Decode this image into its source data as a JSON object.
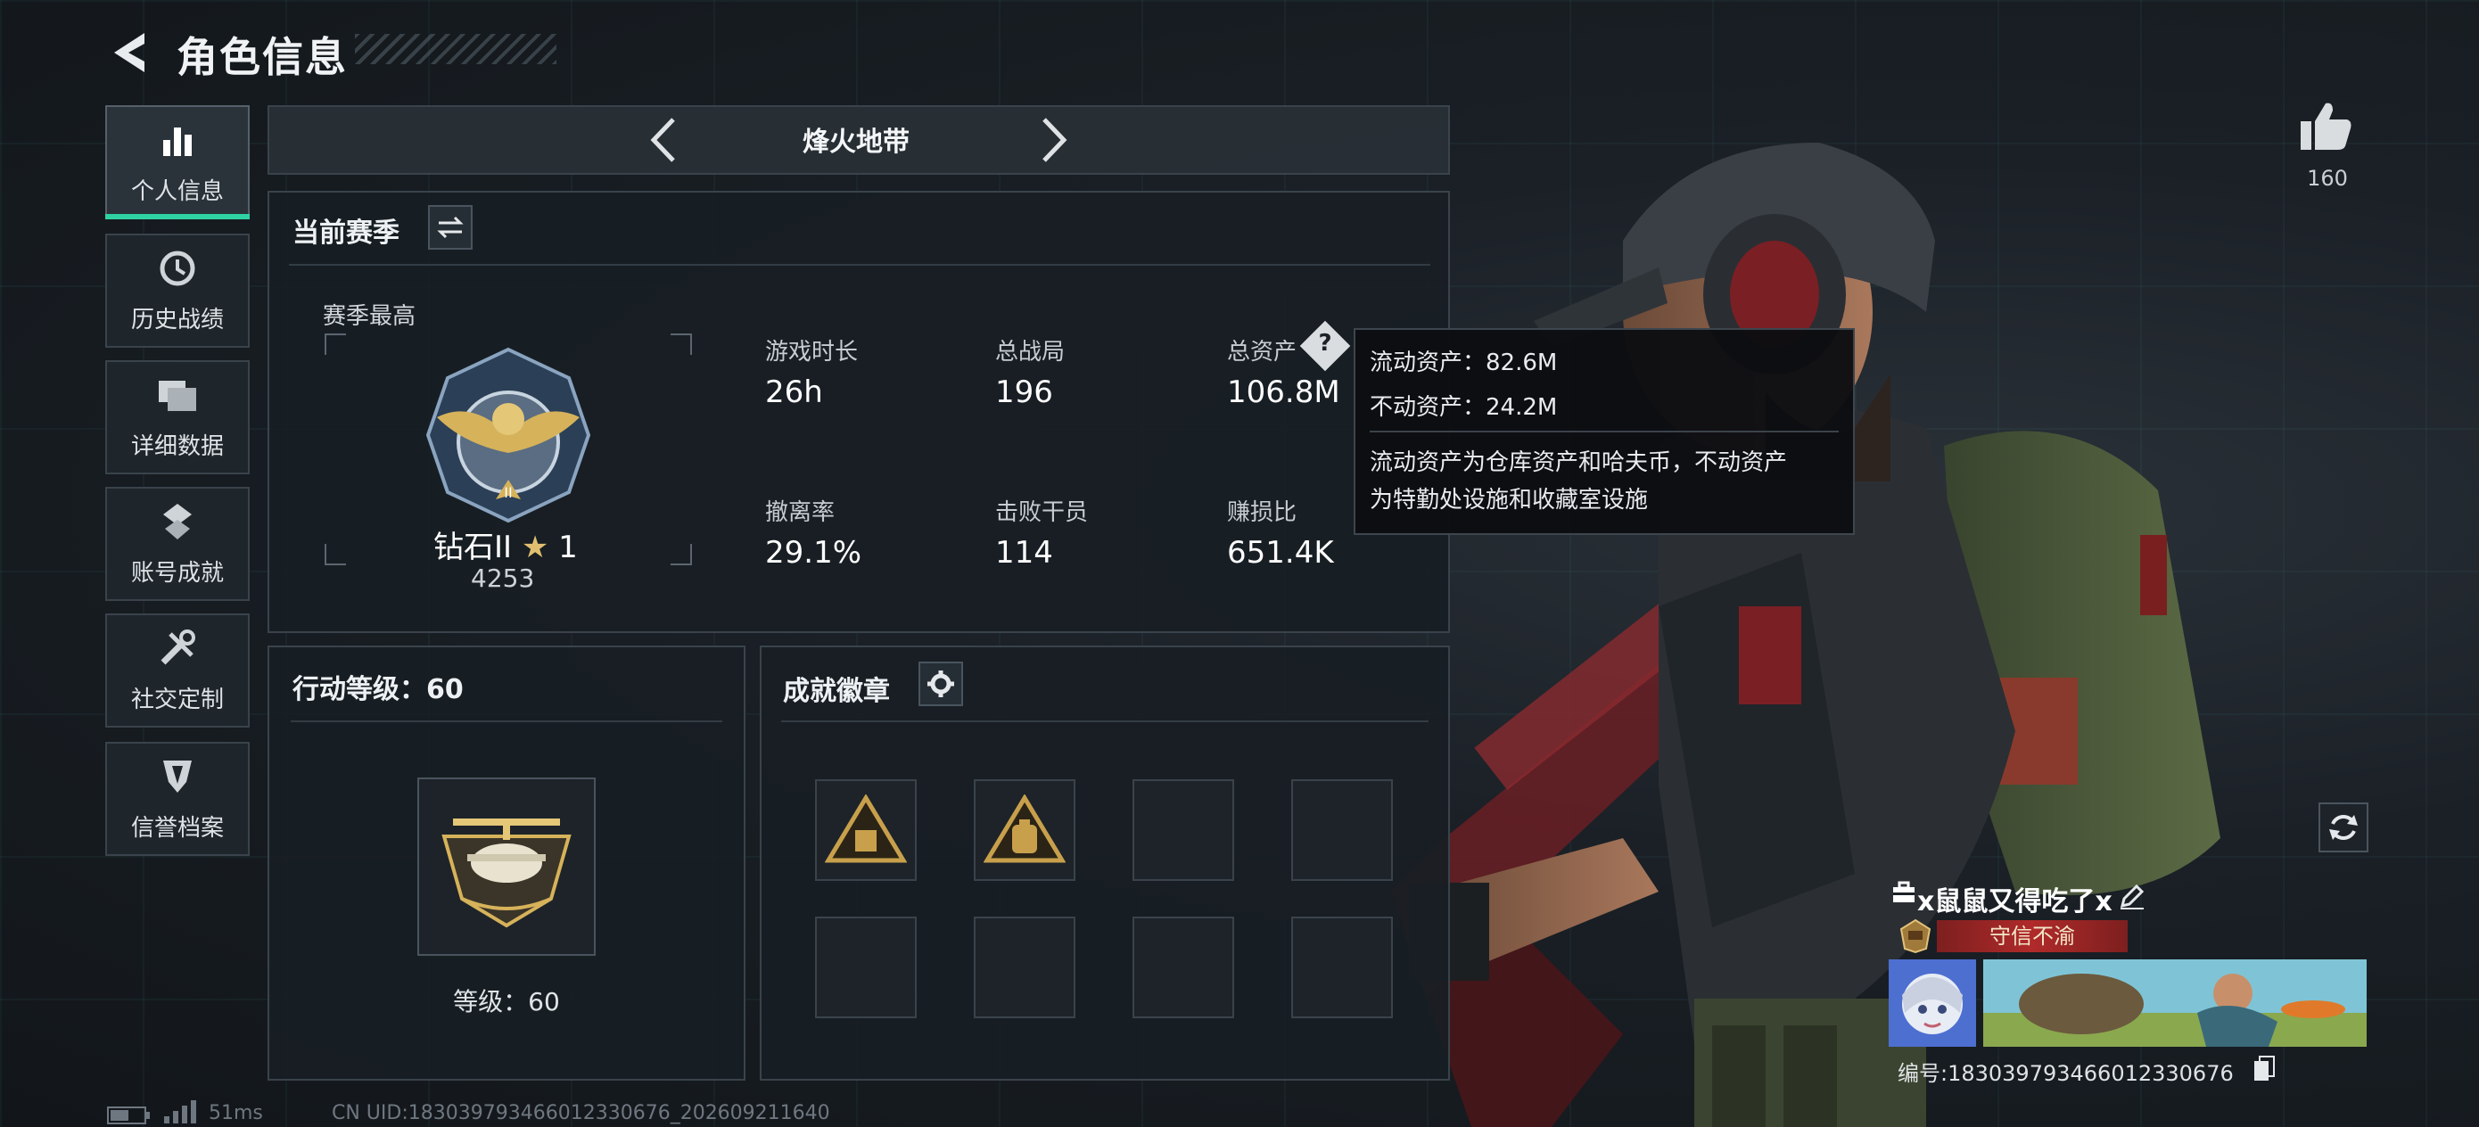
{
  "header": {
    "title": "角色信息"
  },
  "nav": [
    {
      "label": "个人信息",
      "icon": "bar-chart-icon",
      "active": true
    },
    {
      "label": "历史战绩",
      "icon": "history-clock-icon",
      "active": false
    },
    {
      "label": "详细数据",
      "icon": "folders-icon",
      "active": false
    },
    {
      "label": "账号成就",
      "icon": "achievement-icon",
      "active": false
    },
    {
      "label": "社交定制",
      "icon": "tools-icon",
      "active": false
    },
    {
      "label": "信誉档案",
      "icon": "reputation-icon",
      "active": false
    }
  ],
  "mode_tab": {
    "title": "烽火地带"
  },
  "season": {
    "title": "当前赛季",
    "best_label": "赛季最高",
    "rank_name": "钻石II",
    "rank_stars": "1",
    "rank_score": "4253",
    "stats": [
      {
        "label": "游戏时长",
        "value": "26h"
      },
      {
        "label": "总战局",
        "value": "196"
      },
      {
        "label": "总资产",
        "value": "106.8M"
      },
      {
        "label": "撤离率",
        "value": "29.1%"
      },
      {
        "label": "击败干员",
        "value": "114"
      },
      {
        "label": "赚损比",
        "value": "651.4K"
      }
    ]
  },
  "tooltip": {
    "liquid": "流动资产：82.6M",
    "fixed": "不动资产：24.2M",
    "desc_line1": "流动资产为仓库资产和哈夫币，不动资产",
    "desc_line2": "为特勤处设施和收藏室设施"
  },
  "action_level": {
    "title": "行动等级：60",
    "level_text": "等级：60"
  },
  "badges": {
    "title": "成就徽章",
    "slots_filled": 2,
    "slots_total": 8
  },
  "profile": {
    "likes": "160",
    "player_name": "x鼠鼠又得吃了x",
    "title_badge": "守信不渝",
    "uid_label": "编号:18303979346601233067​6"
  },
  "status": {
    "ping": "51ms",
    "uid_footer": "CN UID:18303979346601233067​6_202609211640"
  },
  "colors": {
    "accent": "#2fd2a3",
    "gold": "#d6b25a",
    "badge_red": "#b02a2a"
  }
}
